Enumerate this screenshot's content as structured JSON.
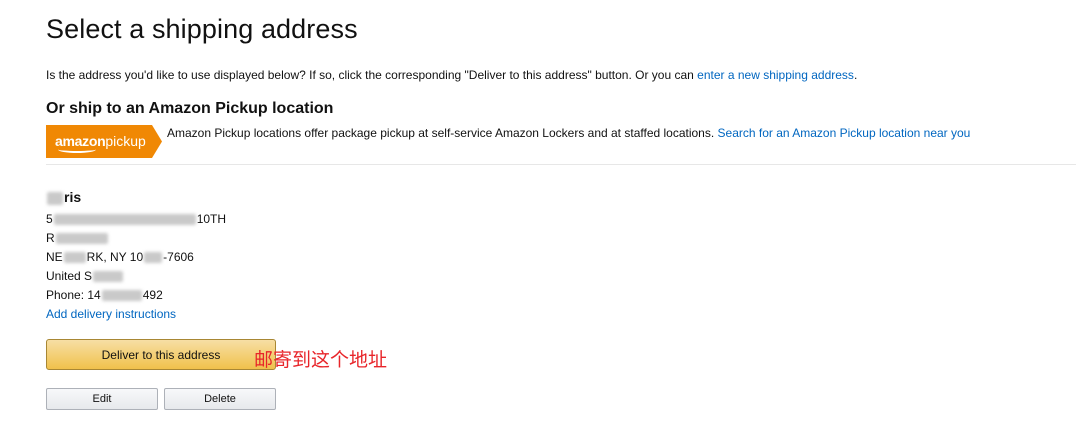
{
  "page": {
    "title": "Select a shipping address",
    "intro_text": "Is the address you'd like to use displayed below? If so, click the corresponding \"Deliver to this address\" button. Or you can ",
    "intro_link": "enter a new shipping address",
    "intro_end": "."
  },
  "pickup": {
    "heading": "Or ship to an Amazon Pickup location",
    "logo_brand": "amazon",
    "logo_suffix": "pickup",
    "description": "Amazon Pickup locations offer package pickup at self-service Amazon Lockers and at staffed locations. ",
    "search_link": "Search for an Amazon Pickup location near you",
    "accent_color": "#f08804"
  },
  "address": {
    "name_visible": "ris",
    "line1_prefix": "5",
    "line1_suffix": "10TH",
    "line2_prefix": "R",
    "city_prefix": "NE",
    "city_mid": "RK, NY 10",
    "city_suffix": "-7606",
    "country_prefix": "United S",
    "phone_prefix": "Phone: 14",
    "phone_suffix": "492",
    "add_instructions_link": "Add delivery instructions"
  },
  "actions": {
    "deliver_label": "Deliver to this address",
    "edit_label": "Edit",
    "delete_label": "Delete"
  },
  "annotation": {
    "text": "邮寄到这个地址",
    "color": "#e8252a"
  },
  "colors": {
    "link": "#0066c0",
    "primary_button": "#f0c14b",
    "secondary_button": "#e7e9ec"
  }
}
